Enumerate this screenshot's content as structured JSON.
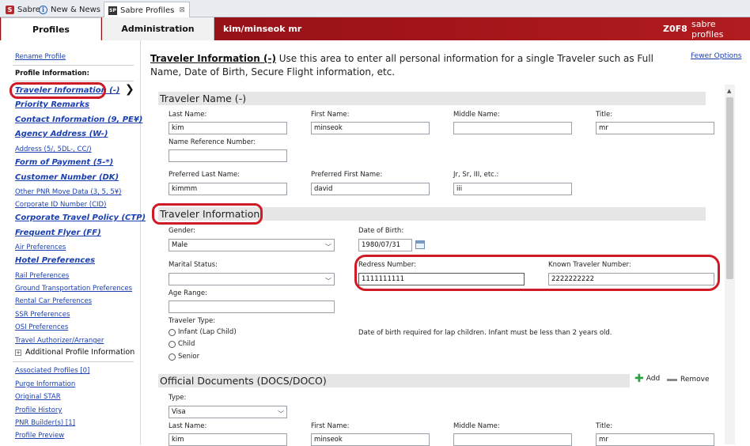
{
  "tabs": [
    {
      "label": "Sabre",
      "icon": "sabre-logo-icon"
    },
    {
      "label": "New & News",
      "icon": "info-icon"
    },
    {
      "label": "Sabre Profiles",
      "icon": "profiles-app-icon",
      "close": "⊠"
    }
  ],
  "nav": {
    "profiles": "Profiles",
    "administration": "Administration",
    "user": "kim/minseok mr",
    "code": "Z0F8",
    "brand": "sabre profiles"
  },
  "sidebar": {
    "rename": "Rename Profile",
    "profile_info": "Profile Information:",
    "items": [
      "Traveler Information (-)",
      "Priority Remarks",
      "Contact Information (9, PE¥)",
      "Agency Address (W-)",
      "Address (5/, 5DL-, CC/)",
      "Form of Payment (5-*)",
      "Customer Number (DK)",
      "Other PNR Move Data (3, 5, 5¥)",
      "Corporate ID Number (CID)",
      "Corporate Travel Policy (CTP)",
      "Frequent Flyer (FF)",
      "Air Preferences",
      "Hotel Preferences",
      "Rail Preferences",
      "Ground Transportation Preferences",
      "Rental Car Preferences",
      "SSR Preferences",
      "OSI Preferences",
      "Travel Authorizer/Arranger"
    ],
    "additional": "Additional Profile Information",
    "lower": [
      "Associated Profiles [0]",
      "Purge Information",
      "Original STAR",
      "Profile History",
      "PNR Builder(s) [1]",
      "Profile Preview"
    ]
  },
  "intro": {
    "title": "Traveler Information (-)",
    "text": " Use this area to enter all personal information for a single Traveler such as Full Name, Date of Birth, Secure Flight information, etc.",
    "fewer": "Fewer Options"
  },
  "name_section": {
    "header": "Traveler Name (-)",
    "last_name_label": "Last Name:",
    "last_name": "kim",
    "first_name_label": "First Name:",
    "first_name": "minseok",
    "middle_name_label": "Middle Name:",
    "middle_name": "",
    "title_label": "Title:",
    "title": "mr",
    "name_ref_label": "Name Reference Number:",
    "name_ref": "",
    "pref_last_label": "Preferred Last Name:",
    "pref_last": "kimmm",
    "pref_first_label": "Preferred First Name:",
    "pref_first": "david",
    "suffix_label": "Jr, Sr, III, etc.:",
    "suffix": "iii"
  },
  "info_section": {
    "header": "Traveler Information",
    "gender_label": "Gender:",
    "gender": "Male",
    "dob_label": "Date of Birth:",
    "dob": "1980/07/31",
    "marital_label": "Marital Status:",
    "marital": "",
    "redress_label": "Redress Number:",
    "redress": "1111111111",
    "ktn_label": "Known Traveler Number:",
    "ktn": "2222222222",
    "age_label": "Age Range:",
    "age": "",
    "type_label": "Traveler Type:",
    "types": [
      "Infant (Lap Child)",
      "Child",
      "Senior"
    ],
    "dob_note": "Date of birth required for lap children. Infant must be less than 2 years old."
  },
  "docs_section": {
    "header": "Official Documents (DOCS/DOCO)",
    "add": "Add",
    "remove": "Remove",
    "type_label": "Type:",
    "type": "Visa",
    "last_name_label": "Last Name:",
    "last_name": "kim",
    "first_name_label": "First Name:",
    "first_name": "minseok",
    "middle_name_label": "Middle Name:",
    "title_label": "Title:",
    "title": "mr"
  },
  "colors": {
    "brand_red": "#a3151a",
    "link_blue": "#1a3fb0",
    "highlight": "#d01a26"
  }
}
